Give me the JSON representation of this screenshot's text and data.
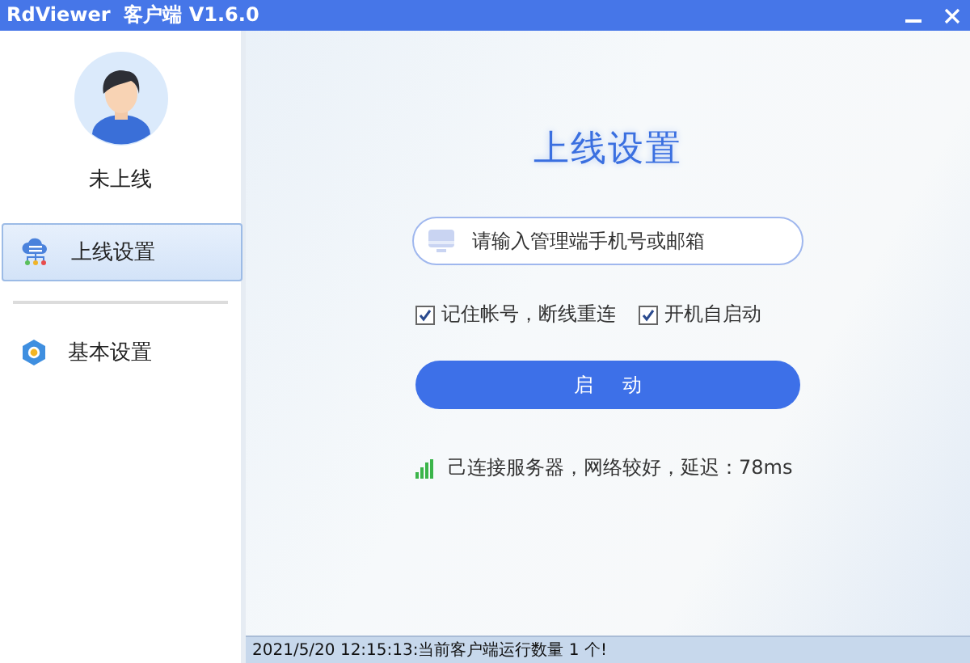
{
  "window": {
    "title": "RdViewer  客户端 V1.6.0"
  },
  "user": {
    "status": "未上线"
  },
  "sidebar": {
    "items": [
      {
        "label": "上线设置",
        "kind": "cloud",
        "selected": true
      },
      {
        "label": "基本设置",
        "kind": "gear",
        "selected": false
      }
    ]
  },
  "main": {
    "heading": "上线设置",
    "account_field": {
      "placeholder": "请输入管理端手机号或邮箱"
    },
    "options": [
      {
        "label": "记住帐号，断线重连",
        "checked": true
      },
      {
        "label": "开机自启动",
        "checked": true
      }
    ],
    "start_button": "启 动",
    "connection": {
      "text": "己连接服务器，网络较好，延迟：78ms"
    }
  },
  "status_bar": "2021/5/20 12:15:13:当前客户端运行数量 1 个!"
}
